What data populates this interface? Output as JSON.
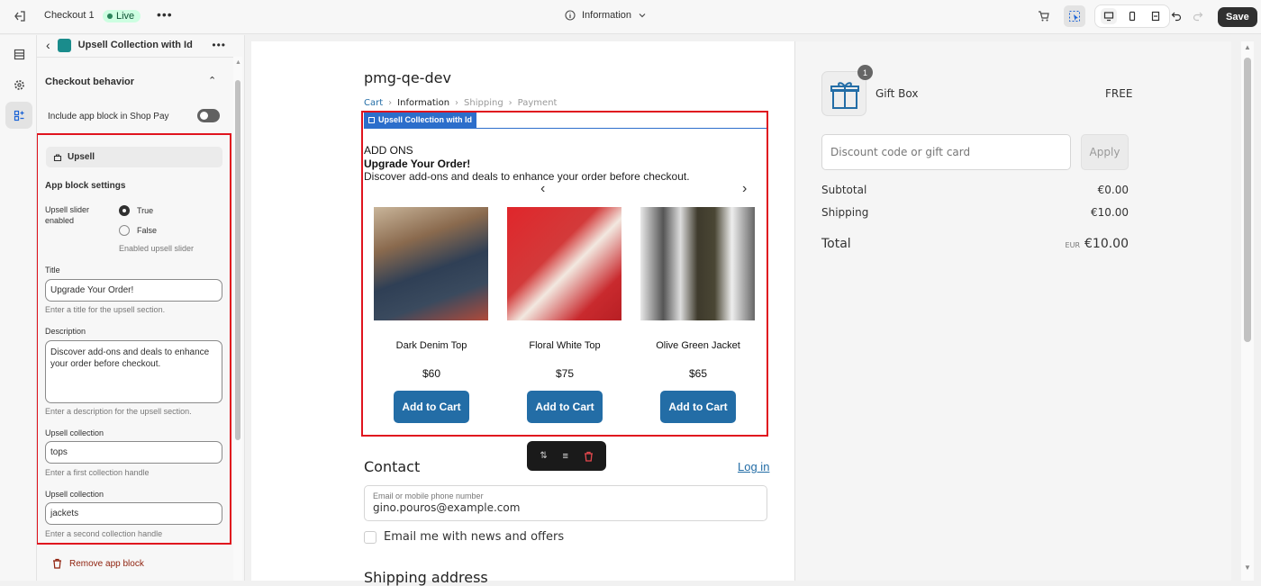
{
  "topbar": {
    "page_name": "Checkout 1",
    "status": "Live",
    "center_label": "Information",
    "save_label": "Save"
  },
  "sidebar": {
    "block_title": "Upsell Collection with Id",
    "checkout_behavior": "Checkout behavior",
    "shop_pay_label": "Include app block in Shop Pay",
    "upsell_chip": "Upsell",
    "settings_heading": "App block settings",
    "slider_label": "Upsell slider enabled",
    "opt_true": "True",
    "opt_false": "False",
    "slider_help": "Enabled upsell slider",
    "title_label": "Title",
    "title_value": "Upgrade Your Order!",
    "title_help": "Enter a title for the upsell section.",
    "desc_label": "Description",
    "desc_value": "Discover add-ons and deals to enhance your order before checkout.",
    "desc_help": "Enter a description for the upsell section.",
    "coll1_label": "Upsell collection",
    "coll1_value": "tops",
    "coll1_help": "Enter a first collection handle",
    "coll2_label": "Upsell collection",
    "coll2_value": "jackets",
    "coll2_help": "Enter a second collection handle",
    "remove_label": "Remove app block"
  },
  "checkout": {
    "store_name": "pmg-qe-dev",
    "breadcrumb": [
      "Cart",
      "Information",
      "Shipping",
      "Payment"
    ],
    "block_tag": "Upsell Collection with Id",
    "addons_heading": "ADD ONS",
    "upsell_title": "Upgrade Your Order!",
    "upsell_desc": "Discover add-ons and deals to enhance your order before checkout.",
    "products": [
      {
        "name": "Dark Denim Top",
        "price": "$60",
        "button": "Add to Cart"
      },
      {
        "name": "Floral White Top",
        "price": "$75",
        "button": "Add to Cart"
      },
      {
        "name": "Olive Green Jacket",
        "price": "$65",
        "button": "Add to Cart"
      }
    ],
    "contact_heading": "Contact",
    "login_link": "Log in",
    "email_label": "Email or mobile phone number",
    "email_value": "gino.pouros@example.com",
    "newsletter_label": "Email me with news and offers",
    "shipping_heading": "Shipping address"
  },
  "summary": {
    "item_qty": "1",
    "item_name": "Gift Box",
    "item_price": "FREE",
    "discount_placeholder": "Discount code or gift card",
    "apply_label": "Apply",
    "subtotal_label": "Subtotal",
    "subtotal_value": "€0.00",
    "shipping_label": "Shipping",
    "shipping_value": "€10.00",
    "total_label": "Total",
    "currency": "EUR",
    "total_value": "€10.00"
  },
  "colors": {
    "accent_blue": "#236da6",
    "highlight_red": "#e0141e",
    "live_green": "#29845a"
  }
}
